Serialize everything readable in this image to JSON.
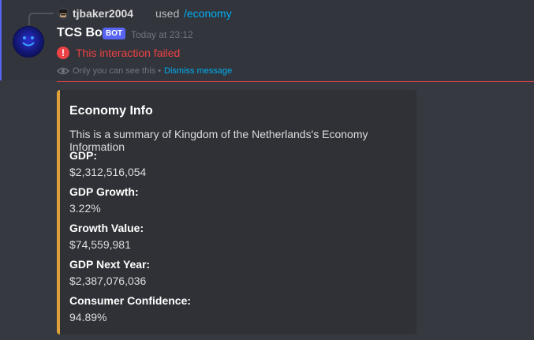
{
  "reply": {
    "username": "tjbaker2004",
    "used_text": "used",
    "command": "/economy"
  },
  "message": {
    "bot_name": "TCS Bot",
    "bot_tag": "BOT",
    "timestamp": "Today at 23:12",
    "error_text": "This interaction failed",
    "ephemeral_note": "Only you can see this •",
    "dismiss_label": "Dismiss message"
  },
  "embed": {
    "accent_color": "#e0a03a",
    "title": "Economy Info",
    "description": "This is a summary of Kingdom of the Netherlands's Economy Information",
    "fields": [
      {
        "name": "GDP:",
        "value": "$2,312,516,054"
      },
      {
        "name": "GDP Growth:",
        "value": "3.22%"
      },
      {
        "name": "Growth Value:",
        "value": "$74,559,981"
      },
      {
        "name": "GDP Next Year:",
        "value": "$2,387,076,036"
      },
      {
        "name": "Consumer Confidence:",
        "value": "94.89%"
      }
    ]
  },
  "colors": {
    "error": "#ed4245",
    "link": "#00aff4",
    "brand": "#5865f2"
  },
  "icons": {
    "reply_avatar": "user-avatar-icon",
    "bot_avatar": "smiley-face-icon",
    "error": "exclamation-circle-icon",
    "ephemeral": "eye-icon"
  }
}
